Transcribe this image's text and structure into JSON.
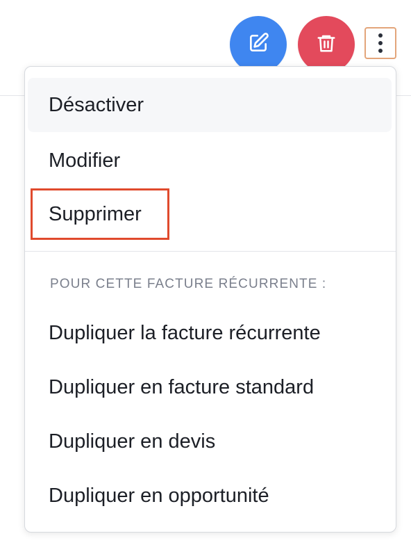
{
  "toolbar": {
    "edit_icon": "edit-icon",
    "delete_icon": "trash-icon",
    "more_icon": "more-vertical-icon"
  },
  "colors": {
    "edit": "#3f86f0",
    "delete": "#e34a5c",
    "focus_outline": "#e3a57a",
    "highlight": "#e04a2d"
  },
  "menu": {
    "items": [
      {
        "label": "Désactiver"
      },
      {
        "label": "Modifier"
      },
      {
        "label": "Supprimer"
      }
    ],
    "section_label": "POUR CETTE FACTURE RÉCURRENTE :",
    "section_items": [
      {
        "label": "Dupliquer la facture récurrente"
      },
      {
        "label": "Dupliquer en facture standard"
      },
      {
        "label": "Dupliquer en devis"
      },
      {
        "label": "Dupliquer en opportunité"
      }
    ]
  }
}
